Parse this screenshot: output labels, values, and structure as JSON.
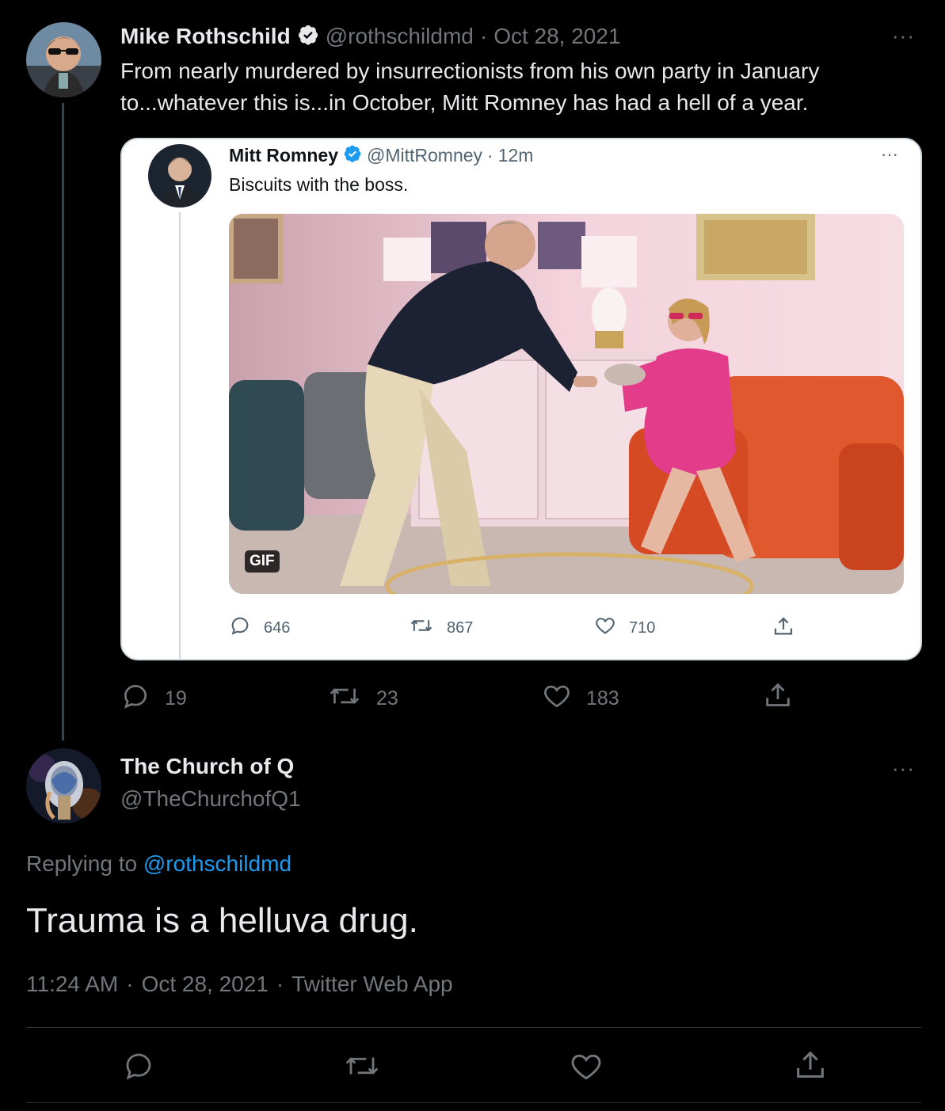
{
  "main_tweet": {
    "author_name": "Mike Rothschild",
    "handle": "@rothschildmd",
    "separator": "·",
    "date": "Oct 28, 2021",
    "text_line1": "From nearly murdered by insurrectionists from his own party in January",
    "text_line2": "to...whatever this is...in October, Mitt Romney has had a hell of a year.",
    "more_label": "···",
    "stats": {
      "replies": "19",
      "retweets": "23",
      "likes": "183"
    }
  },
  "quoted_tweet": {
    "author_name": "Mitt Romney",
    "handle": "@MittRomney",
    "separator": "·",
    "time": "12m",
    "text": "Biscuits with the boss.",
    "more_label": "···",
    "gif_badge": "GIF",
    "stats": {
      "replies": "646",
      "retweets": "867",
      "likes": "710"
    }
  },
  "reply_tweet": {
    "author_name": "The Church of Q",
    "handle": "@TheChurchofQ1",
    "more_label": "···",
    "replying_prefix": "Replying to",
    "replying_handle": "@rothschildmd",
    "text": "Trauma is a helluva drug.",
    "time": "11:24 AM",
    "separator": "·",
    "date": "Oct 28, 2021",
    "source": "Twitter Web App"
  },
  "colors": {
    "background": "#000000",
    "link": "#1d9bf0",
    "verified": "#1d9bf0",
    "muted": "#71767b"
  }
}
